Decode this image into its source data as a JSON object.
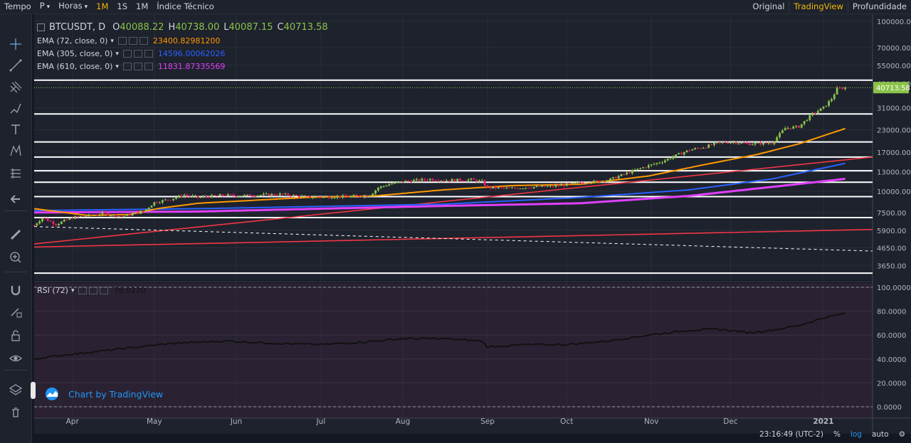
{
  "topbar": {
    "left": [
      {
        "label": "Tempo",
        "caret": false,
        "active": false
      },
      {
        "label": "P",
        "caret": true,
        "active": false
      },
      {
        "label": "Horas",
        "caret": true,
        "active": false
      },
      {
        "label": "1M",
        "caret": false,
        "active": true
      },
      {
        "label": "1S",
        "caret": false,
        "active": false
      },
      {
        "label": "1M",
        "caret": false,
        "active": false
      },
      {
        "label": "Índice Técnico",
        "caret": false,
        "active": false
      }
    ],
    "right": [
      {
        "label": "Original",
        "active": false
      },
      {
        "label": "TradingView",
        "active": true
      },
      {
        "label": "Profundidade",
        "active": false
      }
    ]
  },
  "toolbar_icons": [
    "crosshair-icon",
    "trend-line-icon",
    "pitchfork-icon",
    "brush-icon",
    "text-icon",
    "pattern-icon",
    "forecast-icon",
    "back-arrow-icon",
    "ruler-icon",
    "zoom-in-icon",
    "magnet-icon",
    "lock-draw-icon",
    "lock-icon",
    "eye-icon",
    "layers-icon",
    "trash-icon"
  ],
  "header": {
    "symbol": "BTCUSDT, D",
    "open_label": "O",
    "open": "40088.22",
    "high_label": "H",
    "high": "40738.00",
    "low_label": "L",
    "low": "40087.15",
    "close_label": "C",
    "close": "40713.58"
  },
  "indicators": [
    {
      "name": "EMA (72, close, 0)",
      "value": "23400.82981200",
      "color": "#ff9800"
    },
    {
      "name": "EMA (305, close, 0)",
      "value": "14596.00062026",
      "color": "#2962ff"
    },
    {
      "name": "EMA (610, close, 0)",
      "value": "11831.87335569",
      "color": "#e040fb"
    }
  ],
  "rsi": {
    "name": "RSI (72)",
    "value": "78.0220",
    "color": "#111111"
  },
  "watermark": "Chart by TradingView",
  "bottom": {
    "time": "23:16:49 (UTC-2)",
    "percent": "%",
    "log": "log",
    "auto": "auto"
  },
  "colors": {
    "up": "#8bc34a",
    "down": "#e91e63",
    "ema72": "#ff9800",
    "ema305": "#2962ff",
    "ema610": "#e040fb",
    "trendline": "#f23645",
    "price_badge": "#8bc34a"
  },
  "chart_data": {
    "type": "candlestick",
    "y_scale": "log",
    "y_ticks": [
      "100000.00",
      "70000.00",
      "55000.00",
      "43000.00",
      "31000.00",
      "23000.00",
      "17000.00",
      "13000.00",
      "10000.00",
      "7500.00",
      "5900.00",
      "4650.00",
      "3650.00"
    ],
    "y_tick_values": [
      100000,
      70000,
      55000,
      43000,
      31000,
      23000,
      17000,
      13000,
      10000,
      7500,
      5900,
      4650,
      3650
    ],
    "x_labels": [
      "Apr",
      "May",
      "Jun",
      "Jul",
      "Aug",
      "Sep",
      "Oct",
      "Nov",
      "Dec",
      "2021"
    ],
    "x_label_days": [
      14,
      44,
      74,
      105,
      135,
      166,
      195,
      226,
      255,
      289
    ],
    "last_price": "40713.58",
    "last_price_value": 40713.58,
    "horizontal_levels": [
      45000,
      28500,
      19500,
      15900,
      13200,
      11300,
      9300,
      7000,
      3300
    ],
    "price_keys": [
      [
        0,
        6300
      ],
      [
        3,
        7000
      ],
      [
        8,
        6400
      ],
      [
        14,
        7000
      ],
      [
        20,
        7200
      ],
      [
        25,
        7400
      ],
      [
        32,
        7100
      ],
      [
        40,
        7600
      ],
      [
        44,
        8600
      ],
      [
        50,
        9000
      ],
      [
        55,
        9500
      ],
      [
        60,
        9200
      ],
      [
        70,
        9500
      ],
      [
        75,
        9400
      ],
      [
        90,
        9600
      ],
      [
        100,
        9250
      ],
      [
        115,
        9300
      ],
      [
        123,
        9500
      ],
      [
        126,
        10500
      ],
      [
        130,
        11000
      ],
      [
        135,
        11400
      ],
      [
        145,
        11800
      ],
      [
        150,
        11600
      ],
      [
        160,
        11700
      ],
      [
        164,
        11400
      ],
      [
        166,
        10500
      ],
      [
        175,
        10400
      ],
      [
        182,
        10600
      ],
      [
        190,
        10700
      ],
      [
        200,
        11200
      ],
      [
        210,
        11600
      ],
      [
        220,
        13300
      ],
      [
        230,
        15000
      ],
      [
        236,
        16500
      ],
      [
        240,
        17500
      ],
      [
        246,
        18300
      ],
      [
        250,
        19200
      ],
      [
        255,
        19500
      ],
      [
        262,
        19000
      ],
      [
        270,
        19200
      ],
      [
        275,
        23500
      ],
      [
        280,
        24000
      ],
      [
        285,
        28500
      ],
      [
        289,
        31000
      ],
      [
        292,
        35000
      ],
      [
        294,
        40000
      ],
      [
        297,
        40713.58
      ]
    ],
    "ema72_keys": [
      [
        0,
        7900
      ],
      [
        20,
        7200
      ],
      [
        35,
        7300
      ],
      [
        45,
        7900
      ],
      [
        60,
        8500
      ],
      [
        100,
        9200
      ],
      [
        125,
        9400
      ],
      [
        150,
        10200
      ],
      [
        175,
        10800
      ],
      [
        200,
        11000
      ],
      [
        225,
        12300
      ],
      [
        245,
        14300
      ],
      [
        265,
        16500
      ],
      [
        280,
        19000
      ],
      [
        297,
        23400.83
      ]
    ],
    "ema305_keys": [
      [
        0,
        7700
      ],
      [
        60,
        7900
      ],
      [
        150,
        8400
      ],
      [
        200,
        9200
      ],
      [
        240,
        10200
      ],
      [
        270,
        11800
      ],
      [
        297,
        14596.0
      ]
    ],
    "ema610_keys": [
      [
        0,
        7500
      ],
      [
        60,
        7600
      ],
      [
        150,
        8200
      ],
      [
        200,
        8500
      ],
      [
        240,
        9400
      ],
      [
        270,
        10600
      ],
      [
        297,
        11831.87
      ]
    ],
    "trend_up_line": [
      [
        0,
        4900
      ],
      [
        307,
        15900
      ]
    ],
    "trend_up_line2": [
      [
        0,
        4700
      ],
      [
        307,
        5960
      ]
    ],
    "trend_dash_line": [
      [
        0,
        6200
      ],
      [
        307,
        4450
      ]
    ],
    "rsi_range": [
      0,
      100
    ],
    "rsi_ticks": [
      "100.0000",
      "80.0000",
      "60.0000",
      "40.0000",
      "20.0000",
      "0.0000"
    ],
    "rsi_tick_values": [
      100,
      80,
      60,
      40,
      20,
      0
    ],
    "rsi_keys": [
      [
        0,
        40
      ],
      [
        10,
        43
      ],
      [
        30,
        48
      ],
      [
        50,
        53
      ],
      [
        70,
        55
      ],
      [
        90,
        53
      ],
      [
        105,
        52
      ],
      [
        120,
        54
      ],
      [
        135,
        57
      ],
      [
        150,
        57
      ],
      [
        164,
        55
      ],
      [
        166,
        50
      ],
      [
        180,
        52
      ],
      [
        195,
        52
      ],
      [
        210,
        55
      ],
      [
        225,
        60
      ],
      [
        240,
        64
      ],
      [
        250,
        65
      ],
      [
        262,
        62
      ],
      [
        270,
        64
      ],
      [
        280,
        68
      ],
      [
        290,
        75
      ],
      [
        297,
        78.02
      ]
    ]
  }
}
